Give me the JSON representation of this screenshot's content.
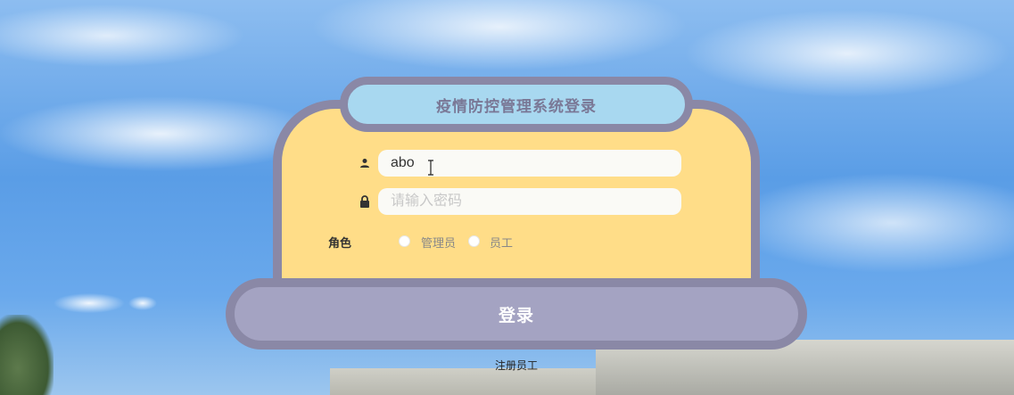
{
  "login": {
    "title": "疫情防控管理系统登录",
    "username": {
      "value": "abo",
      "icon": "user-icon"
    },
    "password": {
      "value": "",
      "placeholder": "请输入密码",
      "icon": "lock-icon"
    },
    "role": {
      "label": "角色",
      "options": [
        "管理员",
        "员工"
      ],
      "selected": null
    },
    "submit_label": "登录",
    "register_label": "注册员工"
  },
  "colors": {
    "card_fill": "#ffdd88",
    "card_border": "#8a88a6",
    "title_fill": "#a8d8f0",
    "button_fill": "#a4a3c2"
  }
}
